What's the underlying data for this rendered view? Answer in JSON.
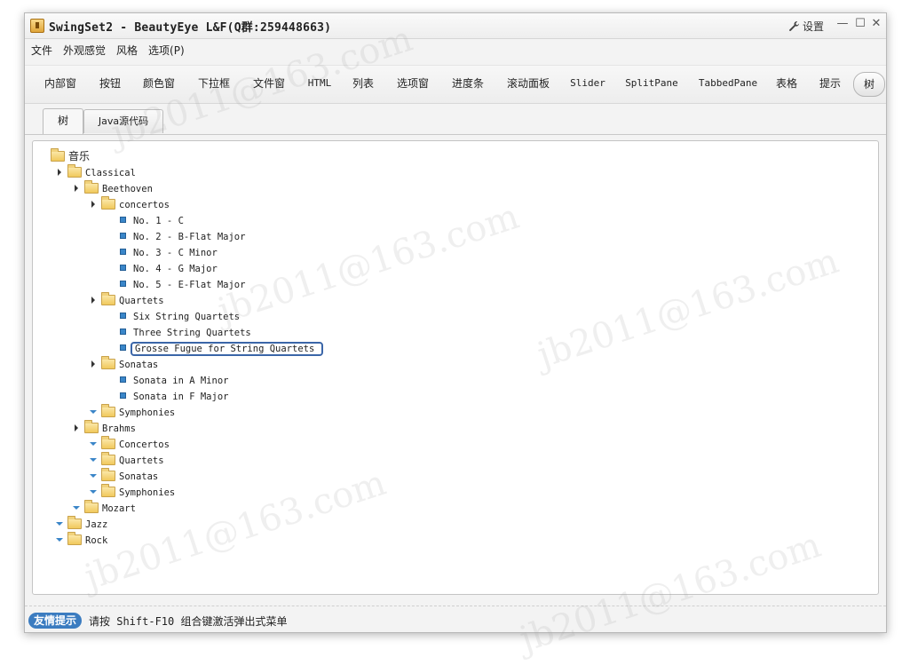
{
  "window": {
    "title": "SwingSet2 - BeautyEye L&F(Q群:259448663)",
    "settings_label": "设置",
    "min_label": "—",
    "max_label": "☐",
    "close_label": "✕"
  },
  "menu": [
    "文件",
    "外观感觉",
    "风格",
    "选项(P)"
  ],
  "toolbar": [
    {
      "label": "内部窗",
      "mono": false
    },
    {
      "label": "按钮",
      "mono": false
    },
    {
      "label": "颜色窗",
      "mono": false
    },
    {
      "label": "下拉框",
      "mono": false
    },
    {
      "label": "文件窗",
      "mono": false
    },
    {
      "label": "HTML",
      "mono": true
    },
    {
      "label": "列表",
      "mono": false
    },
    {
      "label": "选项窗",
      "mono": false
    },
    {
      "label": "进度条",
      "mono": false
    },
    {
      "label": "滚动面板",
      "mono": false
    },
    {
      "label": "Slider",
      "mono": true
    },
    {
      "label": "SplitPane",
      "mono": true
    },
    {
      "label": "TabbedPane",
      "mono": true
    },
    {
      "label": "表格",
      "mono": false
    },
    {
      "label": "提示",
      "mono": false
    },
    {
      "label": "树",
      "mono": false,
      "active": true
    }
  ],
  "tabs": [
    {
      "label": "树",
      "selected": true
    },
    {
      "label": "Java源代码",
      "selected": false
    }
  ],
  "tree": [
    {
      "label": "音乐",
      "type": "folder",
      "depth": 0,
      "toggle": "none",
      "root": true
    },
    {
      "label": "Classical",
      "type": "folder",
      "depth": 1,
      "toggle": "collapsed"
    },
    {
      "label": "Beethoven",
      "type": "folder",
      "depth": 2,
      "toggle": "collapsed"
    },
    {
      "label": "concertos",
      "type": "folder",
      "depth": 3,
      "toggle": "collapsed"
    },
    {
      "label": "No. 1 - C",
      "type": "leaf",
      "depth": 4
    },
    {
      "label": "No. 2 - B-Flat Major",
      "type": "leaf",
      "depth": 4
    },
    {
      "label": "No. 3 - C Minor",
      "type": "leaf",
      "depth": 4
    },
    {
      "label": "No. 4 - G Major",
      "type": "leaf",
      "depth": 4
    },
    {
      "label": "No. 5 - E-Flat Major",
      "type": "leaf",
      "depth": 4
    },
    {
      "label": "Quartets",
      "type": "folder",
      "depth": 3,
      "toggle": "collapsed"
    },
    {
      "label": "Six String Quartets",
      "type": "leaf",
      "depth": 4
    },
    {
      "label": "Three String Quartets",
      "type": "leaf",
      "depth": 4
    },
    {
      "label": "Grosse Fugue for String Quartets",
      "type": "leaf",
      "depth": 4,
      "selected": true
    },
    {
      "label": "Sonatas",
      "type": "folder",
      "depth": 3,
      "toggle": "collapsed"
    },
    {
      "label": "Sonata in A Minor",
      "type": "leaf",
      "depth": 4
    },
    {
      "label": "Sonata in F Major",
      "type": "leaf",
      "depth": 4
    },
    {
      "label": "Symphonies",
      "type": "folder",
      "depth": 3,
      "toggle": "expanded"
    },
    {
      "label": "Brahms",
      "type": "folder",
      "depth": 2,
      "toggle": "collapsed"
    },
    {
      "label": "Concertos",
      "type": "folder",
      "depth": 3,
      "toggle": "expanded"
    },
    {
      "label": "Quartets",
      "type": "folder",
      "depth": 3,
      "toggle": "expanded"
    },
    {
      "label": "Sonatas",
      "type": "folder",
      "depth": 3,
      "toggle": "expanded"
    },
    {
      "label": "Symphonies",
      "type": "folder",
      "depth": 3,
      "toggle": "expanded"
    },
    {
      "label": "Mozart",
      "type": "folder",
      "depth": 2,
      "toggle": "expanded"
    },
    {
      "label": "Jazz",
      "type": "folder",
      "depth": 1,
      "toggle": "expanded"
    },
    {
      "label": "Rock",
      "type": "folder",
      "depth": 1,
      "toggle": "expanded"
    }
  ],
  "status": {
    "badge": "友情提示",
    "text": "请按 Shift-F10 组合键激活弹出式菜单"
  },
  "watermark": "jb2011@163.com",
  "colors": {
    "accent": "#3b7cc0",
    "selection_border": "#3b66a8",
    "leaf_icon": "#3a86c9",
    "folder": "#f1c95c"
  }
}
